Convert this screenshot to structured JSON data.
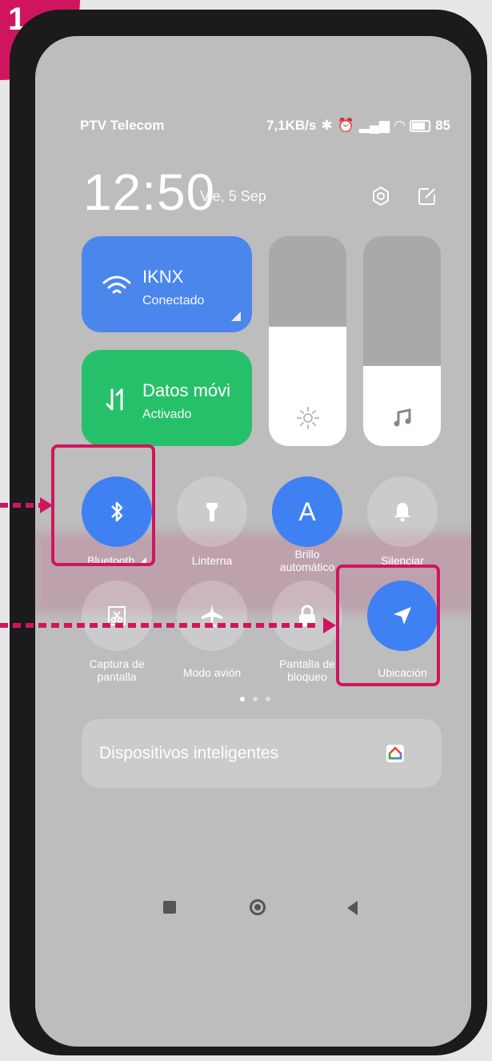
{
  "step_number": "1",
  "status_bar": {
    "carrier": "PTV Telecom",
    "speed": "7,1KB/s",
    "battery": "85"
  },
  "header": {
    "time": "12:50",
    "date": "Vie, 5 Sep",
    "icons": [
      "settings-icon",
      "edit-icon"
    ]
  },
  "tiles": {
    "wifi": {
      "title": "IKNX",
      "subtitle": "Conectado",
      "icon": "wifi-icon"
    },
    "data": {
      "title": "Datos móvi",
      "subtitle": "Activado",
      "icon": "mobile-data-icon"
    }
  },
  "sliders": {
    "brightness": {
      "level": 0.57,
      "icon": "sun-icon"
    },
    "volume": {
      "level": 0.38,
      "icon": "music-note-icon"
    }
  },
  "toggles_row1": [
    {
      "label": "Bluetooth",
      "icon": "bluetooth-icon",
      "active": true
    },
    {
      "label": "Linterna",
      "icon": "flashlight-icon",
      "active": false
    },
    {
      "label": "Brillo automático",
      "icon": "auto-brightness-icon",
      "glyph": "A",
      "active": true
    },
    {
      "label": "Silenciar",
      "icon": "bell-icon",
      "active": false
    }
  ],
  "toggles_row2": [
    {
      "label": "Captura de pantalla",
      "icon": "screenshot-icon",
      "active": false
    },
    {
      "label": "Modo avión",
      "icon": "airplane-icon",
      "active": false
    },
    {
      "label": "Pantalla de bloqueo",
      "icon": "lock-icon",
      "active": false
    },
    {
      "label": "Ubicación",
      "icon": "location-arrow-icon",
      "active": true
    }
  ],
  "page_indicator": {
    "count": 3,
    "active": 1
  },
  "smart_devices": {
    "label": "Dispositivos inteligentes",
    "icon": "google-home-icon"
  },
  "navigation": [
    "recents-icon",
    "home-icon",
    "back-icon"
  ],
  "colors": {
    "accent": "#d0155f",
    "toggle_on": "#3f80f3",
    "wifi_tile": "#4a86ec",
    "data_tile": "#27c06a"
  }
}
